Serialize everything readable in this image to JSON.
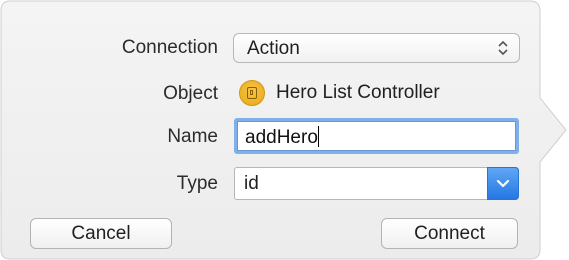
{
  "form": {
    "connection": {
      "label": "Connection",
      "value": "Action"
    },
    "object": {
      "label": "Object",
      "value": "Hero List Controller",
      "icon": "object-icon"
    },
    "name": {
      "label": "Name",
      "value": "addHero"
    },
    "type": {
      "label": "Type",
      "value": "id"
    }
  },
  "buttons": {
    "cancel_label": "Cancel",
    "connect_label": "Connect"
  },
  "icons": {
    "popup_arrows": "popup-stepper-icon",
    "combo_chevron": "chevron-down-icon"
  },
  "colors": {
    "focus_ring": "#7fb0ea",
    "accent": "#2f7fe8",
    "object_icon": "#f0b42e"
  }
}
